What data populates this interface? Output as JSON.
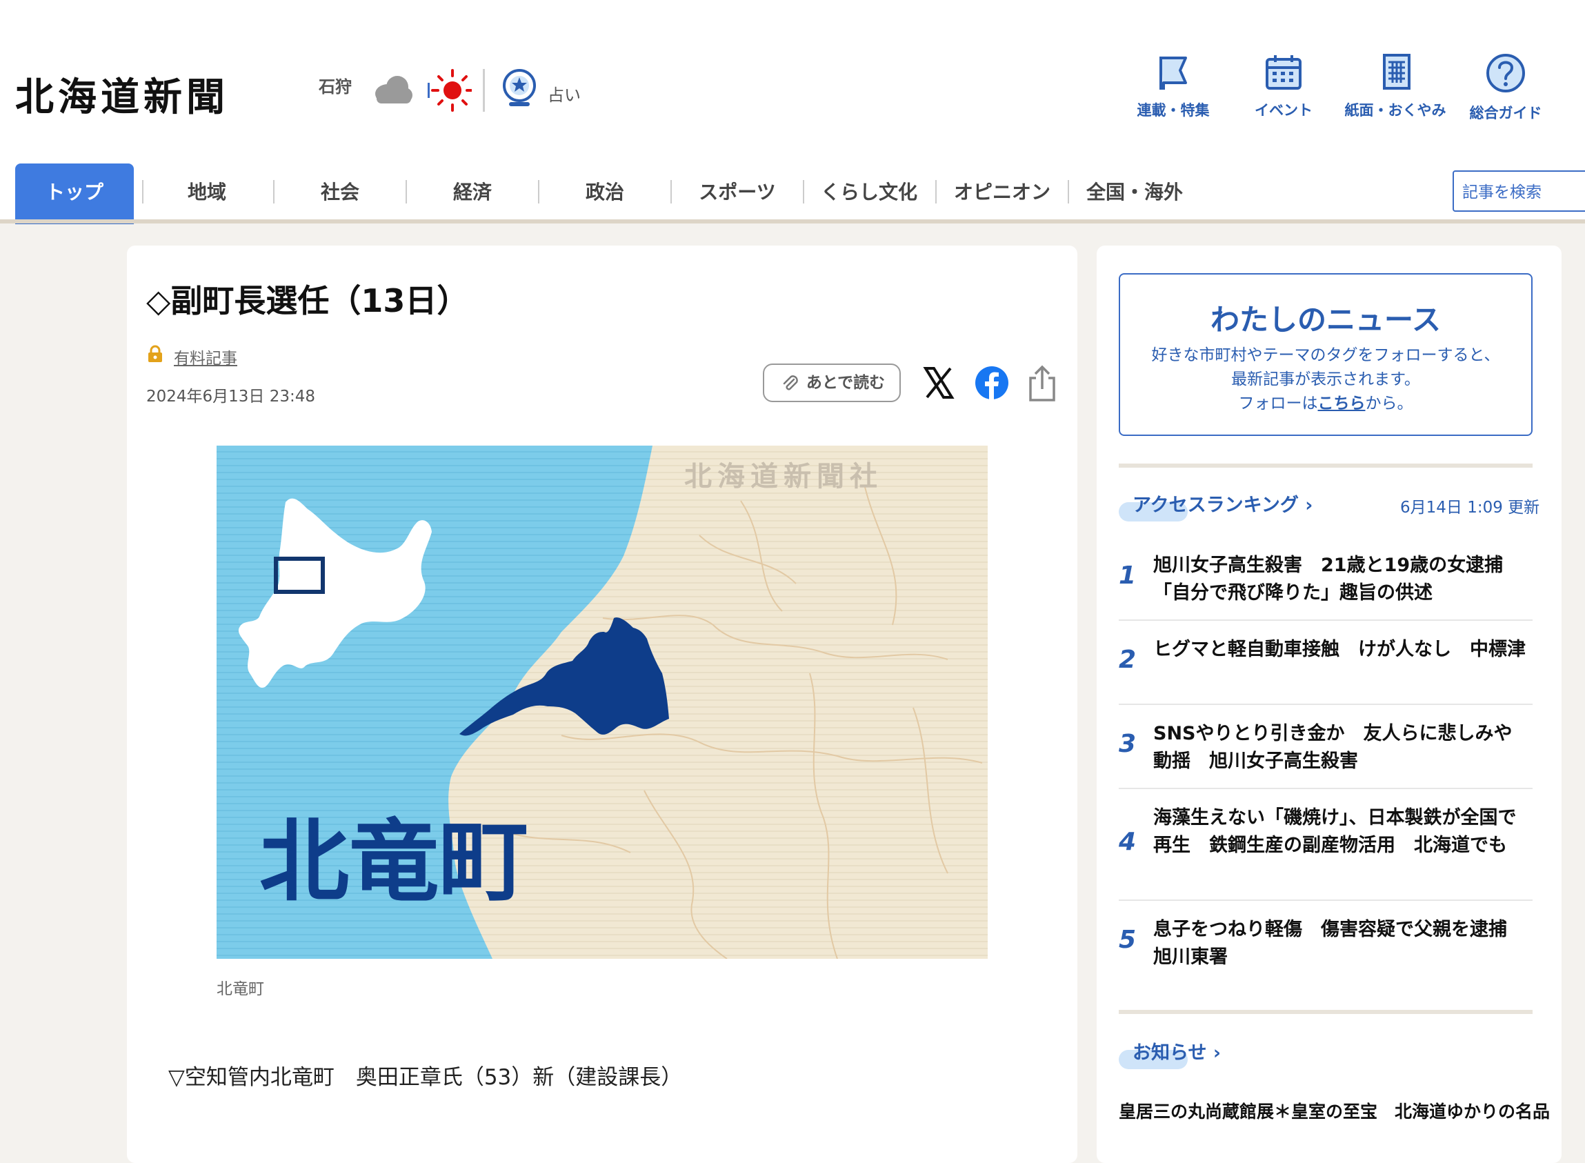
{
  "brand": {
    "logo_text": "北海道新聞"
  },
  "weather": {
    "region": "石狩",
    "icons": [
      "cloud-icon",
      "sun-icon"
    ]
  },
  "fortune": {
    "label": "占い"
  },
  "header_links": [
    {
      "label": "連載・特集",
      "icon": "flag-icon"
    },
    {
      "label": "イベント",
      "icon": "calendar-icon"
    },
    {
      "label": "紙面・おくやみ",
      "icon": "newspaper-icon"
    },
    {
      "label": "総合ガイド",
      "icon": "help-icon"
    }
  ],
  "nav": {
    "items": [
      "トップ",
      "地域",
      "社会",
      "経済",
      "政治",
      "スポーツ",
      "くらし文化",
      "オピニオン",
      "全国・海外"
    ],
    "active": "トップ"
  },
  "search": {
    "placeholder": "記事を検索"
  },
  "article": {
    "title": "◇副町長選任（13日）",
    "paid_label": "有料記事",
    "date": "2024年6月13日 23:48",
    "read_later_label": "あとで読む",
    "share_icons": [
      "x-icon",
      "facebook-icon",
      "share-icon"
    ],
    "map": {
      "watermark": "北海道新聞社",
      "town_label": "北竜町"
    },
    "caption": "北竜町",
    "body": "▽空知管内北竜町　奥田正章氏（53）新（建設課長）"
  },
  "mynews": {
    "title": "わたしのニュース",
    "desc_line1": "好きな市町村やテーマのタグをフォローすると、",
    "desc_line2": "最新記事が表示されます。",
    "desc_prefix": "フォローは",
    "desc_link": "こちら",
    "desc_suffix": "から。"
  },
  "ranking": {
    "title": "アクセスランキング",
    "updated": "6月14日 1:09 更新",
    "items": [
      {
        "rank": "1",
        "text": "旭川女子高生殺害　21歳と19歳の女逮捕「自分で飛び降りた」趣旨の供述"
      },
      {
        "rank": "2",
        "text": "ヒグマと軽自動車接触　けが人なし　中標津"
      },
      {
        "rank": "3",
        "text": "SNSやりとり引き金か　友人らに悲しみや動揺　旭川女子高生殺害"
      },
      {
        "rank": "4",
        "text": "海藻生えない「磯焼け」、日本製鉄が全国で再生　鉄鋼生産の副産物活用　北海道でも"
      },
      {
        "rank": "5",
        "text": "息子をつねり軽傷　傷害容疑で父親を逮捕　旭川東署"
      }
    ]
  },
  "news": {
    "title": "お知らせ",
    "items": [
      "皇居三の丸尚蔵館展＊皇室の至宝　北海道ゆかりの名品"
    ]
  },
  "colors": {
    "accent": "#2a5db0",
    "nav_active": "#3f7be0",
    "map_sea": "#7cccea",
    "map_town": "#0e3d8a"
  }
}
